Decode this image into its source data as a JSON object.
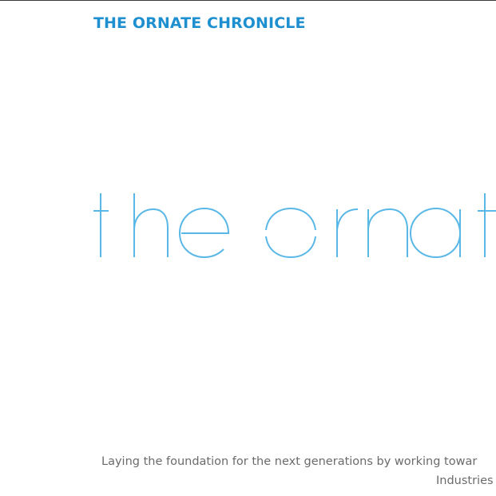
{
  "header": {
    "title": "THE ORNATE CHRONICLE"
  },
  "hero": {
    "wordmark": "the ornat"
  },
  "tagline": {
    "line1": "Laying the foundation for the next generations by working towar",
    "line2": "Industries"
  },
  "colors": {
    "accent": "#1e8fcf",
    "wordmark": "#5ab8e6",
    "muted": "#6b6b6b",
    "rule": "#3a3a3a"
  }
}
